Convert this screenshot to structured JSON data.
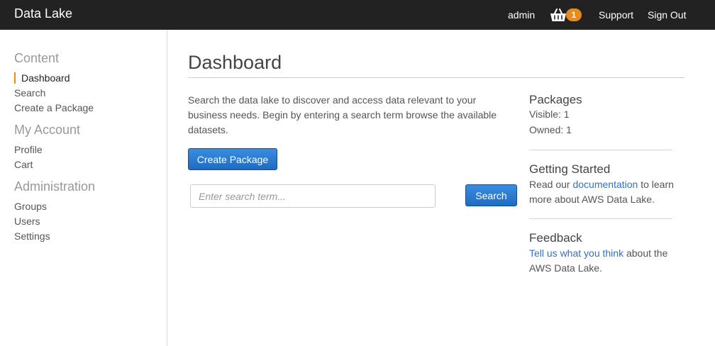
{
  "navbar": {
    "brand": "Data Lake",
    "user": "admin",
    "cart_count": "1",
    "support": "Support",
    "sign_out": "Sign Out",
    "background": "#222222",
    "badge_color": "#e98a1d"
  },
  "sidebar": {
    "sections": [
      {
        "title": "Content",
        "items": [
          "Dashboard",
          "Search",
          "Create a Package"
        ]
      },
      {
        "title": "My Account",
        "items": [
          "Profile",
          "Cart"
        ]
      },
      {
        "title": "Administration",
        "items": [
          "Groups",
          "Users",
          "Settings"
        ]
      }
    ],
    "active_item": "Dashboard",
    "active_color": "#e98a1d"
  },
  "main": {
    "title": "Dashboard",
    "intro": "Search the data lake to discover and access data relevant to your business needs. Begin by entering a search term browse the available datasets.",
    "create_button": "Create Package",
    "search_placeholder": "Enter search term...",
    "search_button": "Search"
  },
  "panel": {
    "packages": {
      "heading": "Packages",
      "visible": "Visible: 1",
      "owned": "Owned: 1"
    },
    "getting_started": {
      "heading": "Getting Started",
      "pre": "Read our ",
      "link": "documentation",
      "post": " to learn more about AWS Data Lake."
    },
    "feedback": {
      "heading": "Feedback",
      "link": "Tell us what you think",
      "post": " about the AWS Data Lake."
    }
  },
  "colors": {
    "primary_button": "#1f6cc1",
    "link": "#3370c2"
  }
}
